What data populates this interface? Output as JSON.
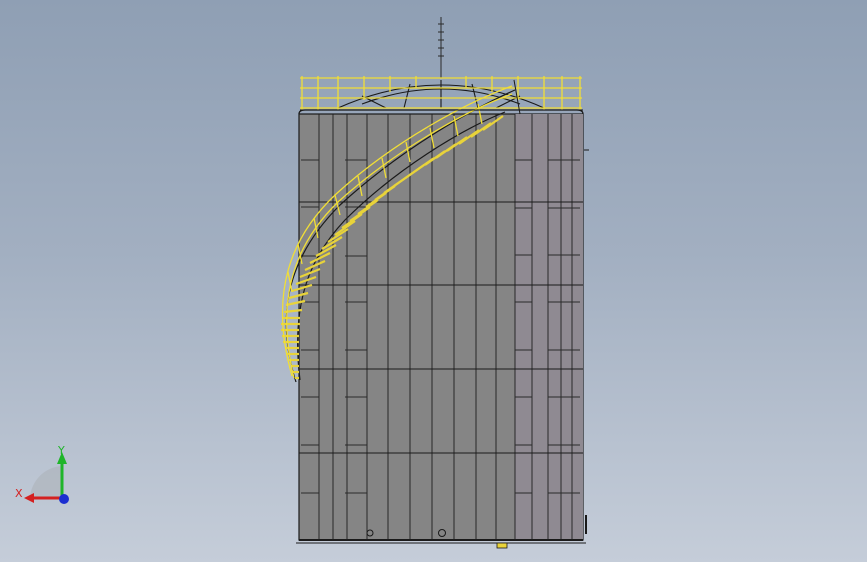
{
  "viewport": {
    "background_top": "#8f9fb4",
    "background_bottom": "#c5cdd9"
  },
  "colors": {
    "shell": "#858585",
    "shell_right": "#8f8a92",
    "outline": "#1a1a1a",
    "stair_yellow": "#e8d33a",
    "rail_yellow": "#f1de36",
    "x_axis": "#d42020",
    "y_axis": "#1fb52a",
    "z_axis": "#1c2fd1"
  },
  "triad": {
    "x_label": "X",
    "y_label": "Y"
  }
}
